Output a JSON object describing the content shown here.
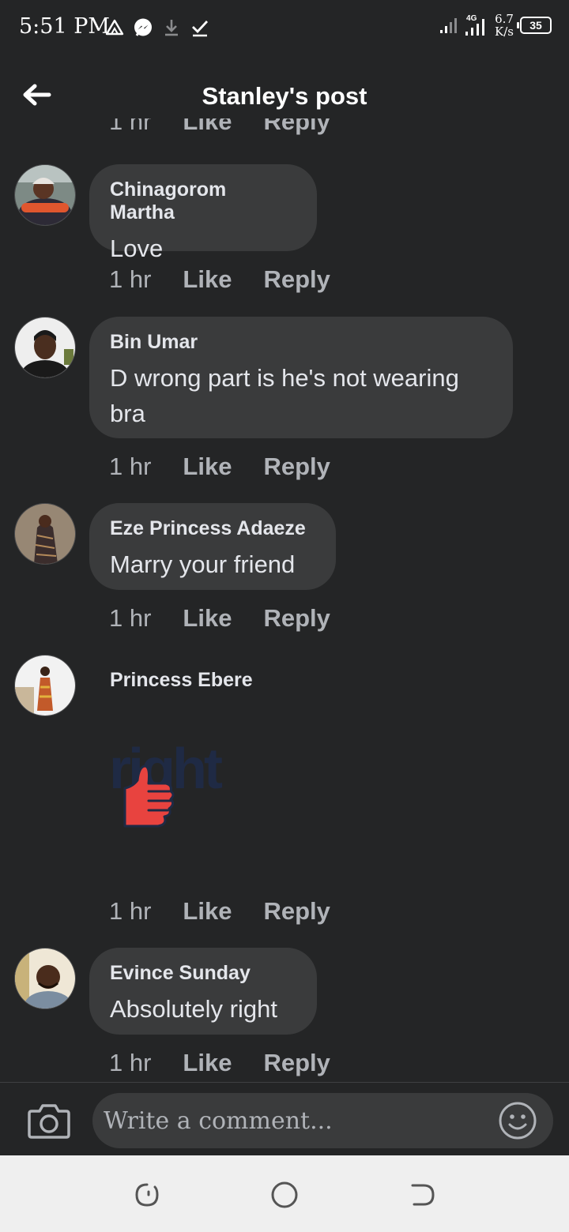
{
  "status_bar": {
    "time": "5:51 PM",
    "net_speed_value": "6.7",
    "net_speed_unit": "K/s",
    "battery": "35",
    "network_type": "4G"
  },
  "header": {
    "title": "Stanley's post"
  },
  "partial_actions": [
    "1 hr",
    "Like",
    "Reply"
  ],
  "comments": [
    {
      "author": "Chinagorom Martha",
      "text": "Love",
      "time": "1 hr",
      "like": "Like",
      "reply": "Reply"
    },
    {
      "author": "Bin Umar",
      "text": "D wrong part is he's not wearing bra",
      "time": "1 hr",
      "like": "Like",
      "reply": "Reply"
    },
    {
      "author": "Eze Princess Adaeze",
      "text": "Marry your friend",
      "time": "1 hr",
      "like": "Like",
      "reply": "Reply"
    },
    {
      "author": "Princess Ebere",
      "sticker_text": "right",
      "time": "1 hr",
      "like": "Like",
      "reply": "Reply"
    },
    {
      "author": "Evince Sunday",
      "text": "Absolutely right",
      "time": "1 hr",
      "like": "Like",
      "reply": "Reply"
    }
  ],
  "composer": {
    "placeholder": "Write a comment..."
  },
  "colors": {
    "background": "#242526",
    "bubble": "#3a3b3c",
    "secondary_text": "#b0b3b8",
    "sticker_red": "#e8433f",
    "sticker_navy": "#1f2a44"
  }
}
